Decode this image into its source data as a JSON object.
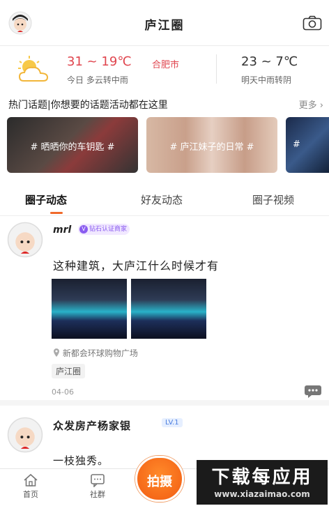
{
  "header": {
    "title": "庐江圈"
  },
  "weather": {
    "today_temp": "31 ~ 19℃",
    "city": "合肥市",
    "today_label": "今日",
    "today_desc": "多云转中雨",
    "tomorrow_temp": "23 ~ 7℃",
    "tomorrow_label": "明天",
    "tomorrow_desc": "中雨转阴"
  },
  "hot": {
    "label": "热门话题|你想要的话题活动都在这里",
    "more": "更多"
  },
  "topics": [
    {
      "label": "# 晒晒你的车钥匙 #"
    },
    {
      "label": "# 庐江妹子的日常 #"
    },
    {
      "label": "#"
    }
  ],
  "tabs": [
    "圈子动态",
    "好友动态",
    "圈子视频"
  ],
  "post1": {
    "username": "mrl",
    "badge": "钻石认证商家",
    "badge_mark": "V",
    "content": "这种建筑，大庐江什么时候才有",
    "location": "新都会环球购物广场",
    "tag": "庐江圈",
    "date": "04-06"
  },
  "post2": {
    "username": "众发房产杨家银",
    "level": "LV.1",
    "content": "一枝独秀。"
  },
  "nav": {
    "home": "首页",
    "community": "社群",
    "shoot": "拍摄"
  },
  "watermark": {
    "title": "下载每应用",
    "url": "www.xiazaimao.com"
  },
  "colors": {
    "accent": "#f06a2b",
    "temp_red": "#e0454e",
    "shoot_orange": "#f25c12"
  }
}
